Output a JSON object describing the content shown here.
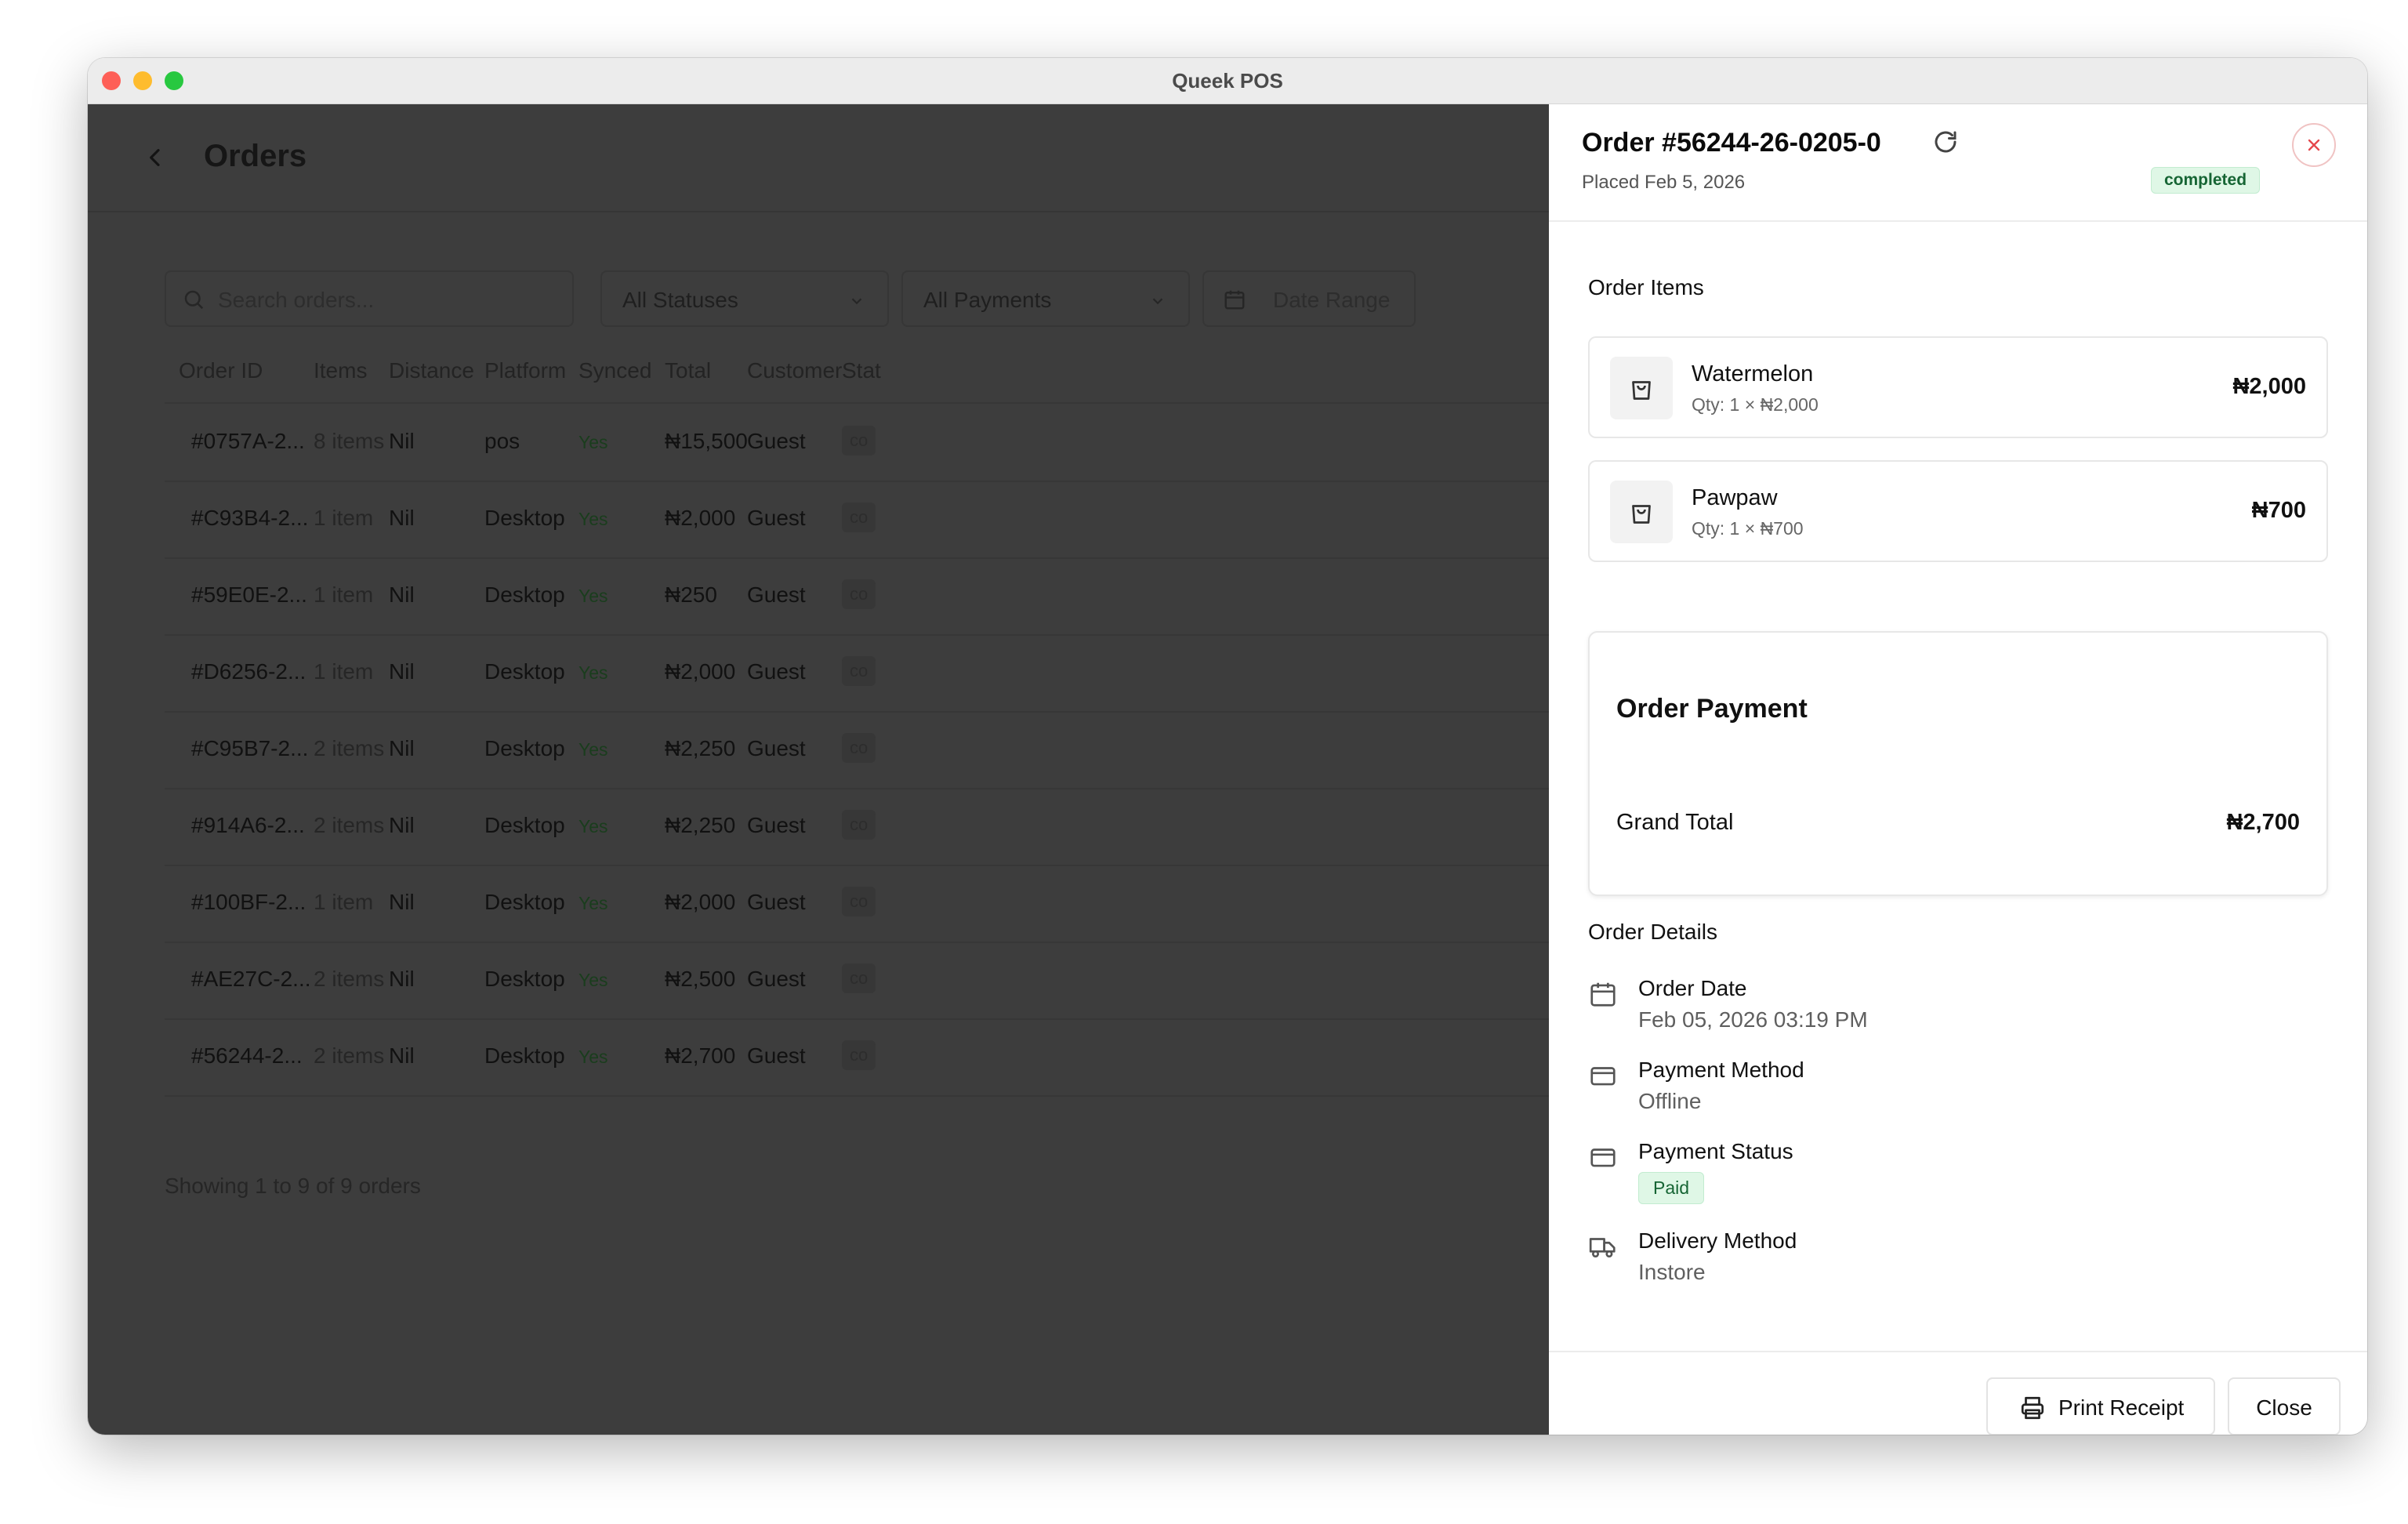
{
  "window": {
    "title": "Queek POS"
  },
  "page": {
    "title": "Orders",
    "filters": {
      "search_placeholder": "Search orders...",
      "status": "All Statuses",
      "payments": "All Payments",
      "date_range": "Date Range"
    },
    "columns": [
      "Order ID",
      "Items",
      "Distance",
      "Platform",
      "Synced",
      "Total",
      "Customer",
      "Stat"
    ],
    "rows": [
      {
        "id": "#0757A-2...",
        "items": "8 items",
        "distance": "Nil",
        "platform": "pos",
        "synced": "Yes",
        "total": "₦15,500",
        "customer": "Guest",
        "status": "co"
      },
      {
        "id": "#C93B4-2...",
        "items": "1 item",
        "distance": "Nil",
        "platform": "Desktop",
        "synced": "Yes",
        "total": "₦2,000",
        "customer": "Guest",
        "status": "co"
      },
      {
        "id": "#59E0E-2...",
        "items": "1 item",
        "distance": "Nil",
        "platform": "Desktop",
        "synced": "Yes",
        "total": "₦250",
        "customer": "Guest",
        "status": "co"
      },
      {
        "id": "#D6256-2...",
        "items": "1 item",
        "distance": "Nil",
        "platform": "Desktop",
        "synced": "Yes",
        "total": "₦2,000",
        "customer": "Guest",
        "status": "co"
      },
      {
        "id": "#C95B7-2...",
        "items": "2 items",
        "distance": "Nil",
        "platform": "Desktop",
        "synced": "Yes",
        "total": "₦2,250",
        "customer": "Guest",
        "status": "co"
      },
      {
        "id": "#914A6-2...",
        "items": "2 items",
        "distance": "Nil",
        "platform": "Desktop",
        "synced": "Yes",
        "total": "₦2,250",
        "customer": "Guest",
        "status": "co"
      },
      {
        "id": "#100BF-2...",
        "items": "1 item",
        "distance": "Nil",
        "platform": "Desktop",
        "synced": "Yes",
        "total": "₦2,000",
        "customer": "Guest",
        "status": "co"
      },
      {
        "id": "#AE27C-2...",
        "items": "2 items",
        "distance": "Nil",
        "platform": "Desktop",
        "synced": "Yes",
        "total": "₦2,500",
        "customer": "Guest",
        "status": "co"
      },
      {
        "id": "#56244-2...",
        "items": "2 items",
        "distance": "Nil",
        "platform": "Desktop",
        "synced": "Yes",
        "total": "₦2,700",
        "customer": "Guest",
        "status": "co"
      }
    ],
    "showing_text": "Showing 1 to 9 of 9 orders"
  },
  "panel": {
    "order_title": "Order #56244-26-0205-0",
    "placed": "Placed Feb 5, 2026",
    "status_badge": "completed",
    "items_title": "Order Items",
    "items": [
      {
        "name": "Watermelon",
        "qty": "Qty: 1 × ₦2,000",
        "price": "₦2,000"
      },
      {
        "name": "Pawpaw",
        "qty": "Qty: 1 × ₦700",
        "price": "₦700"
      }
    ],
    "payment": {
      "title": "Order Payment",
      "grand_total_label": "Grand Total",
      "grand_total_value": "₦2,700"
    },
    "details_title": "Order Details",
    "details": {
      "order_date": {
        "label": "Order Date",
        "value": "Feb 05, 2026 03:19 PM"
      },
      "payment_method": {
        "label": "Payment Method",
        "value": "Offline"
      },
      "payment_status": {
        "label": "Payment Status",
        "value": "Paid"
      },
      "delivery_method": {
        "label": "Delivery Method",
        "value": "Instore"
      }
    },
    "buttons": {
      "print_receipt": "Print Receipt",
      "close": "Close"
    }
  },
  "colors": {
    "overlay_bg": "#3d3d3d",
    "completed_bg": "#dff7e6",
    "completed_text": "#166534",
    "close_icon": "#e5484d"
  }
}
